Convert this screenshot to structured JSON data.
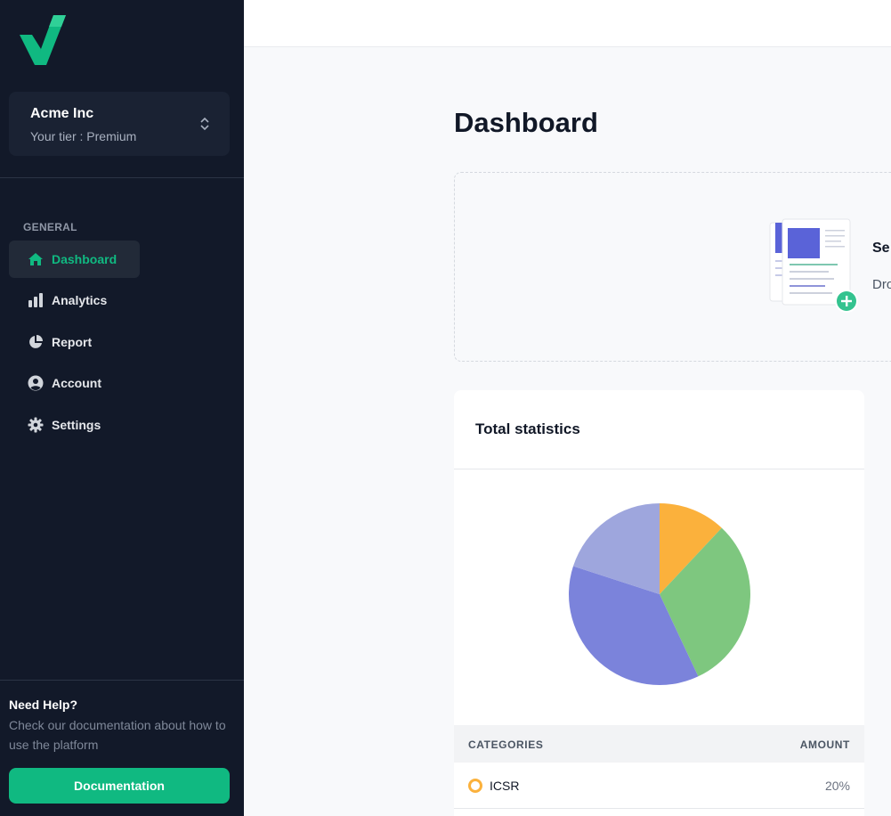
{
  "brand": {
    "accent": "#10b981",
    "sidebar_bg": "#121929",
    "logo": "green-v-logo"
  },
  "organization": {
    "name": "Acme Inc",
    "tier": "Your tier : Premium"
  },
  "nav": {
    "section_label": "GENERAL",
    "items": [
      {
        "label": "Dashboard",
        "icon": "home-icon",
        "active": true
      },
      {
        "label": "Analytics",
        "icon": "bar-chart-icon",
        "active": false
      },
      {
        "label": "Report",
        "icon": "pie-chart-icon",
        "active": false
      },
      {
        "label": "Account",
        "icon": "user-circle-icon",
        "active": false
      },
      {
        "label": "Settings",
        "icon": "gear-icon",
        "active": false
      }
    ]
  },
  "help": {
    "title": "Need Help?",
    "text": "Check our documentation about how to use the platform",
    "button_label": "Documentation"
  },
  "main": {
    "title": "Dashboard",
    "upload": {
      "title_visible": "Se",
      "subtitle_visible": "Dro"
    }
  },
  "statistics": {
    "title": "Total statistics",
    "table": {
      "headers": [
        "CATEGORIES",
        "AMOUNT"
      ],
      "rows": [
        {
          "category": "ICSR",
          "amount": "20%",
          "color": "#fbb13c"
        }
      ]
    }
  },
  "chart_data": {
    "type": "pie",
    "title": "Total statistics",
    "slices": [
      {
        "label": "ICSR",
        "value": 12,
        "color": "#fbb13c"
      },
      {
        "label": "",
        "value": 31,
        "color": "#7ec77f"
      },
      {
        "label": "",
        "value": 37,
        "color": "#7b83db"
      },
      {
        "label": "",
        "value": 20,
        "color": "#9ea6dd"
      }
    ]
  }
}
